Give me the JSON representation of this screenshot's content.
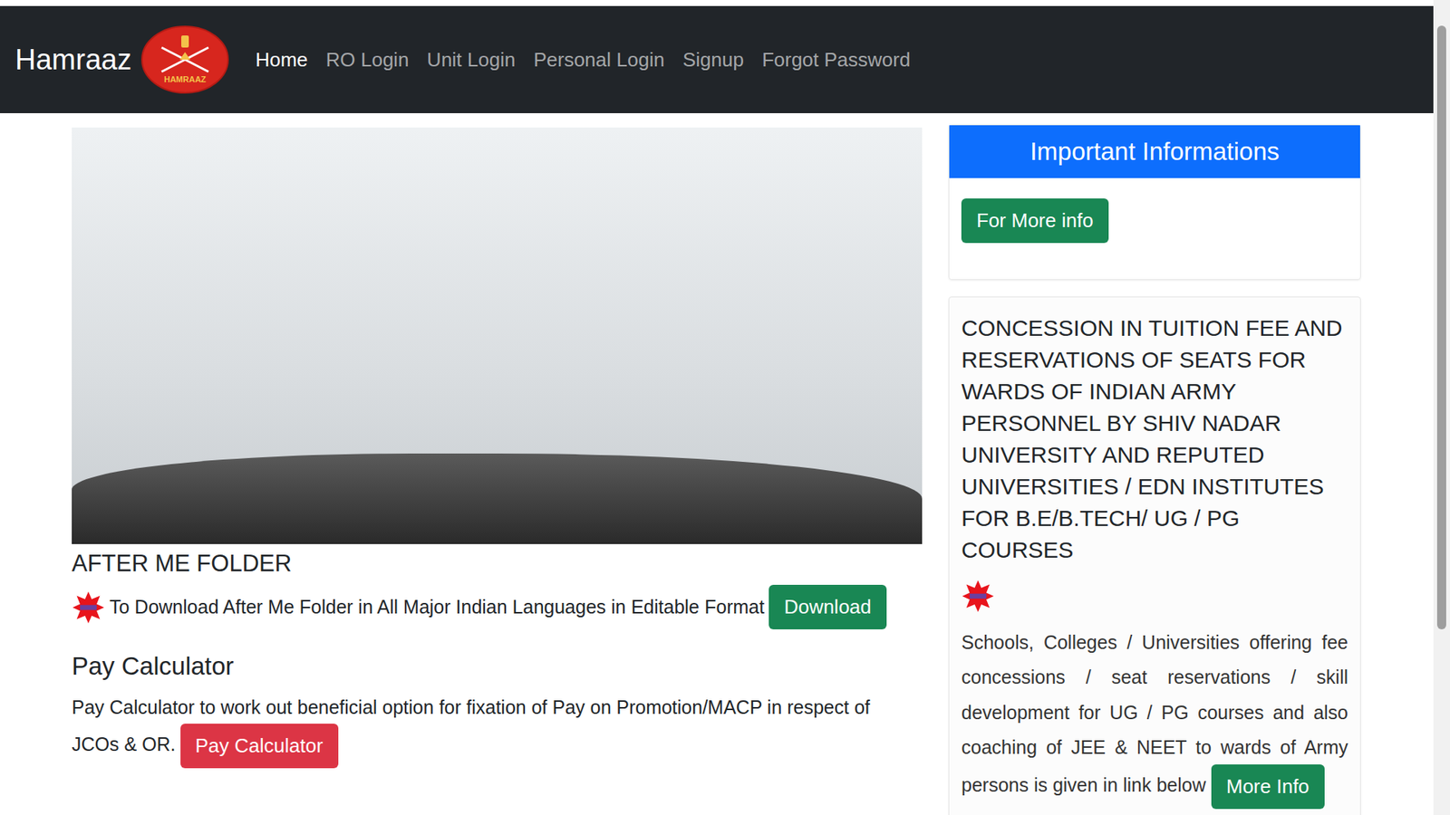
{
  "brand": {
    "name": "Hamraaz",
    "logo_text": "HAMRAAZ"
  },
  "nav": [
    {
      "label": "Home",
      "selected": true
    },
    {
      "label": "RO Login",
      "selected": false
    },
    {
      "label": "Unit Login",
      "selected": false
    },
    {
      "label": "Personal Login",
      "selected": false
    },
    {
      "label": "Signup",
      "selected": false
    },
    {
      "label": "Forgot Password",
      "selected": false
    }
  ],
  "after_me": {
    "heading": "AFTER ME FOLDER",
    "text": "To Download After Me Folder in All Major Indian Languages in Editable Format",
    "button": "Download"
  },
  "pay_calculator": {
    "heading": "Pay Calculator",
    "text": "Pay Calculator to work out beneficial option for fixation of Pay on Promotion/MACP in respect of JCOs & OR.",
    "button": "Pay Calculator"
  },
  "important": {
    "header": "Important Informations",
    "button": "For More info"
  },
  "concession": {
    "title": "CONCESSION IN TUITION FEE AND RESERVATIONS OF SEATS FOR WARDS OF INDIAN ARMY PERSONNEL BY SHIV NADAR UNIVERSITY AND REPUTED UNIVERSITIES / EDN INSTITUTES FOR B.E/B.TECH/ UG / PG COURSES",
    "text": "Schools, Colleges / Universities offering fee concessions / seat reservations / skill development for UG / PG courses and also coaching of JEE & NEET to wards of Army persons is given in link below",
    "button": "More Info"
  }
}
